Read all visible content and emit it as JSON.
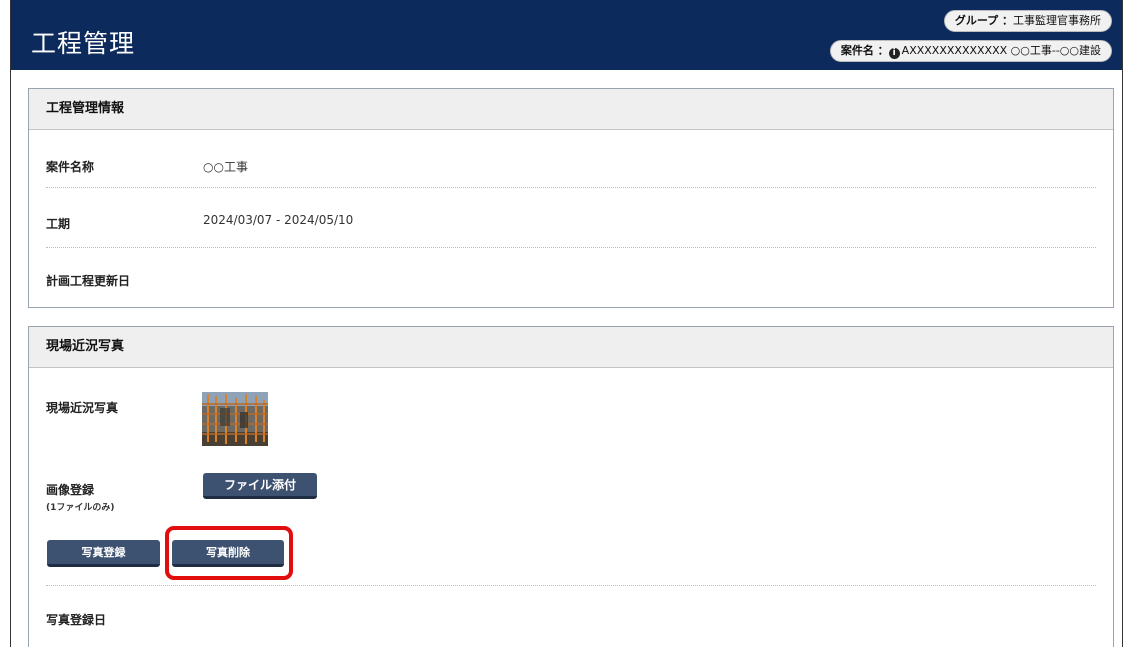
{
  "header": {
    "app_title": "工程管理",
    "group_label": "グループ ：",
    "group_value": "工事監理官事務所",
    "case_label": "案件名 ：",
    "case_value": "AXXXXXXXXXXXXX ○○工事--○○建設"
  },
  "info_section": {
    "title": "工程管理情報",
    "rows": [
      {
        "label": "案件名称",
        "value": "○○工事"
      },
      {
        "label": "工期",
        "value": "2024/03/07 - 2024/05/10"
      },
      {
        "label": "計画工程更新日",
        "value": ""
      }
    ]
  },
  "photo_section": {
    "title": "現場近況写真",
    "photo_label": "現場近況写真",
    "upload_label": "画像登録",
    "upload_note": "(1ファイルのみ)",
    "attach_button": "ファイル添付",
    "register_button": "写真登録",
    "delete_button": "写真削除",
    "registered_date_label": "写真登録日"
  },
  "colors": {
    "header_bg": "#0c2a5c",
    "button_bg": "#3d5170",
    "highlight": "#e20d0d"
  },
  "icons": [
    "info-icon",
    "site-photo-thumbnail"
  ]
}
